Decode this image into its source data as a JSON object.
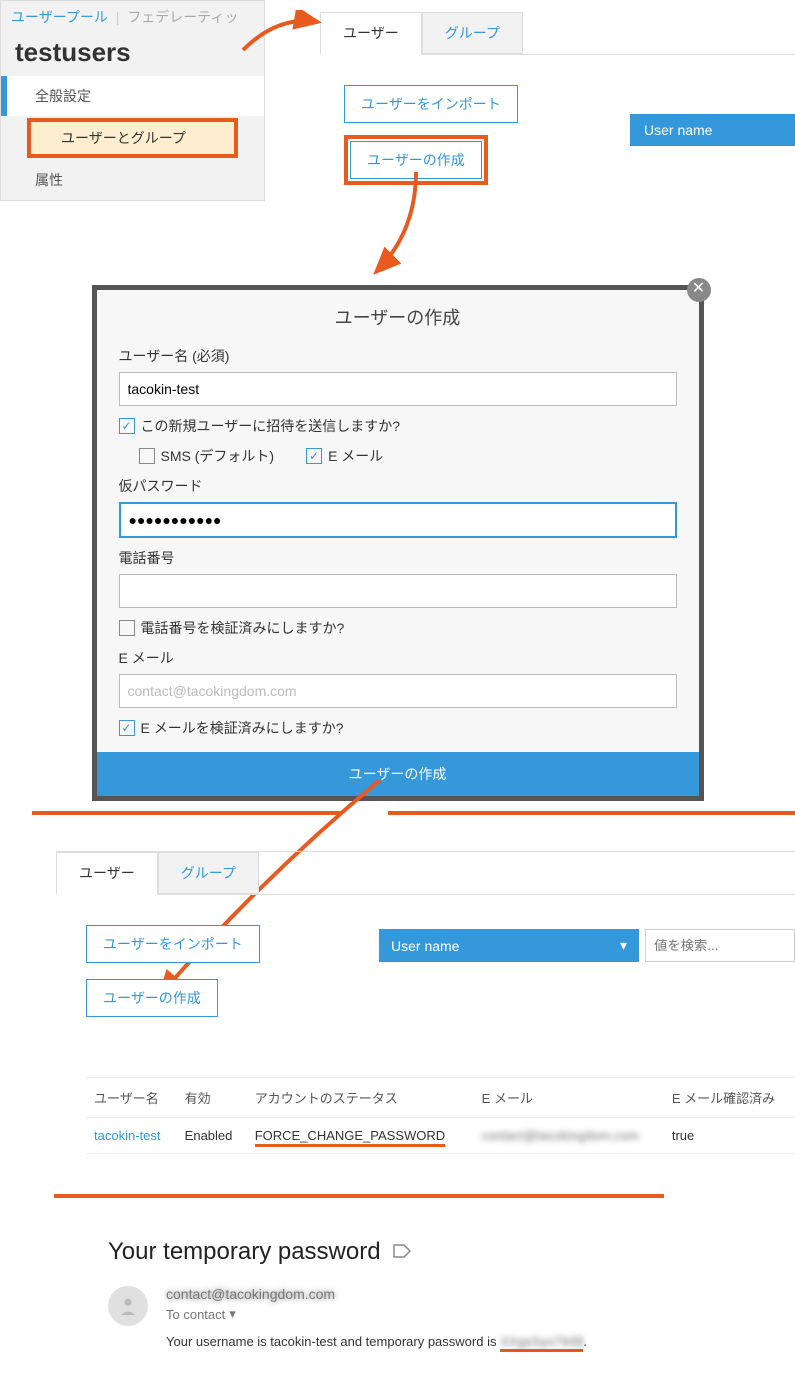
{
  "breadcrumb": {
    "user_pool": "ユーザープール",
    "federated": "フェデレーティッ"
  },
  "pool_name": "testusers",
  "sidebar": {
    "general": "全般設定",
    "users_groups": "ユーザーとグループ",
    "attributes": "属性"
  },
  "tabs": {
    "users": "ユーザー",
    "groups": "グループ"
  },
  "buttons": {
    "import_users": "ユーザーをインポート",
    "create_user": "ユーザーの作成"
  },
  "search": {
    "attr_label": "User name",
    "placeholder": "値を検索..."
  },
  "modal": {
    "title": "ユーザーの作成",
    "username_label": "ユーザー名 (必須)",
    "username_value": "tacokin-test",
    "invite_label": "この新規ユーザーに招待を送信しますか?",
    "sms_label": "SMS (デフォルト)",
    "email_label": "E メール",
    "temp_pw_label": "仮パスワード",
    "temp_pw_value": "●●●●●●●●●●●",
    "phone_label": "電話番号",
    "phone_value": "",
    "phone_verify": "電話番号を検証済みにしますか?",
    "email_field_label": "E メール",
    "email_value": "contact@tacokingdom.com",
    "email_verify": "E メールを検証済みにしますか?",
    "submit": "ユーザーの作成"
  },
  "table": {
    "headers": {
      "username": "ユーザー名",
      "enabled": "有効",
      "account_status": "アカウントのステータス",
      "email": "E メール",
      "email_verified": "E メール確認済み"
    },
    "rows": [
      {
        "username": "tacokin-test",
        "enabled": "Enabled",
        "status": "FORCE_CHANGE_PASSWORD",
        "email": "contact@tacokingdom.com",
        "verified": "true"
      }
    ]
  },
  "email_msg": {
    "subject": "Your temporary password",
    "from": "contact@tacokingdom.com",
    "to_label": "To contact",
    "body_prefix": "Your username is tacokin-test and temporary password is ",
    "temp_pw": "XXgeSyo794$"
  }
}
